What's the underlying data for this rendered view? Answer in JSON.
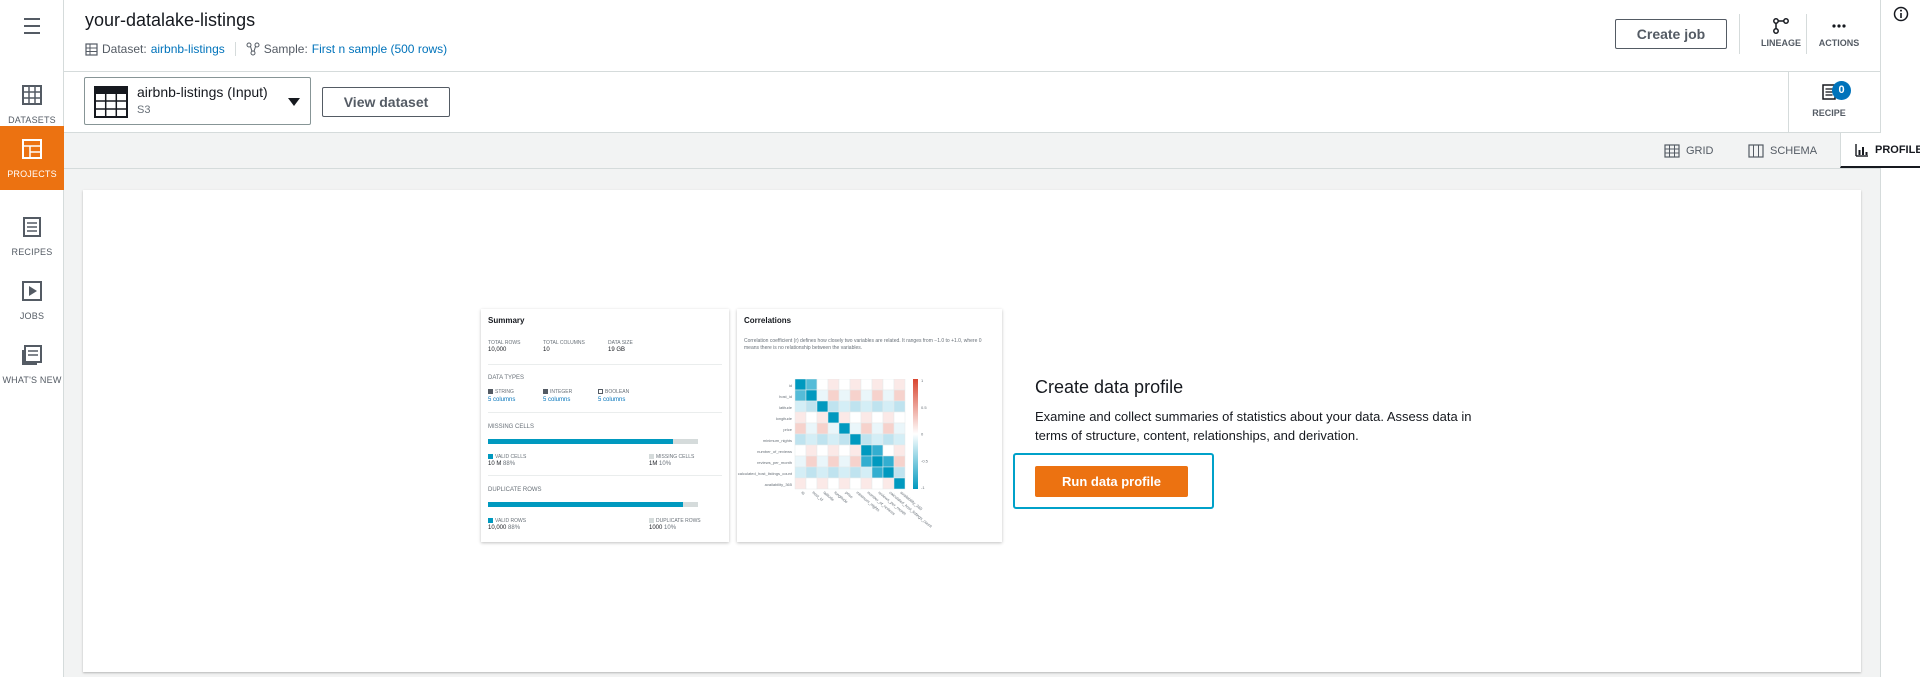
{
  "nav": {
    "items": [
      {
        "label": "DATASETS",
        "icon": "dataset-table-icon"
      },
      {
        "label": "PROJECTS",
        "icon": "projects-icon"
      },
      {
        "label": "RECIPES",
        "icon": "recipes-icon"
      },
      {
        "label": "JOBS",
        "icon": "jobs-play-icon"
      },
      {
        "label": "WHAT'S NEW",
        "icon": "whats-new-icon"
      }
    ],
    "active": "PROJECTS",
    "accent_color": "#ec7211"
  },
  "header": {
    "title": "your-datalake-listings",
    "dataset_prefix": "Dataset:",
    "dataset_link": "airbnb-listings",
    "sample_prefix": "Sample:",
    "sample_link": "First n sample (500 rows)",
    "create_job_label": "Create job",
    "lineage_label": "LINEAGE",
    "actions_label": "ACTIONS"
  },
  "toolbar": {
    "dataset_name": "airbnb-listings (Input)",
    "dataset_source": "S3",
    "view_dataset_label": "View dataset",
    "recipe_label": "RECIPE",
    "recipe_count": "0"
  },
  "view_tabs": [
    {
      "label": "GRID",
      "icon": "grid-icon"
    },
    {
      "label": "SCHEMA",
      "icon": "schema-icon"
    },
    {
      "label": "PROFILE",
      "icon": "profile-chart-icon"
    }
  ],
  "active_view": "PROFILE",
  "summary_card": {
    "title": "Summary",
    "stats": [
      {
        "label": "TOTAL ROWS",
        "value": "10,000"
      },
      {
        "label": "TOTAL COLUMNS",
        "value": "10"
      },
      {
        "label": "DATA SIZE",
        "value": "19 GB"
      }
    ],
    "data_types_label": "DATA TYPES",
    "data_types": [
      {
        "label": "STRING",
        "value": "5 columns"
      },
      {
        "label": "INTEGER",
        "value": "5 columns"
      },
      {
        "label": "BOOLEAN",
        "value": "5 columns"
      }
    ],
    "missing_label": "MISSING CELLS",
    "missing_valid_fraction": 0.88,
    "missing_valid_label": "VALID CELLS",
    "missing_valid_value": "10 M",
    "missing_valid_pct": "88%",
    "missing_missing_label": "MISSING CELLS",
    "missing_missing_value": "1M",
    "missing_missing_pct": "10%",
    "duplicate_label": "DUPLICATE ROWS",
    "duplicate_valid_fraction": 0.93,
    "duplicate_valid_label": "VALID ROWS",
    "duplicate_valid_value": "10,000",
    "duplicate_valid_pct": "88%",
    "duplicate_dup_label": "DUPLICATE ROWS",
    "duplicate_dup_value": "1000",
    "duplicate_dup_pct": "10%"
  },
  "correlations_card": {
    "title": "Correlations",
    "description": "Correlation coefficient (r) defines how closely two variables are related. It ranges from −1.0 to +1.0, where 0 means there is no relationship between the variables.",
    "variables": [
      "id",
      "host_id",
      "latitude",
      "longitude",
      "price",
      "minimum_nights",
      "number_of_reviews",
      "reviews_per_month",
      "calculated_host_listings_count",
      "availability_365"
    ],
    "scale_labels": [
      "-1",
      "-0.5",
      "0",
      "0.5",
      "1"
    ]
  },
  "create_profile": {
    "title": "Create data profile",
    "description": "Examine and collect summaries of statistics about your data. Assess data in terms of structure, content, relationships, and derivation.",
    "run_label": "Run data profile"
  }
}
